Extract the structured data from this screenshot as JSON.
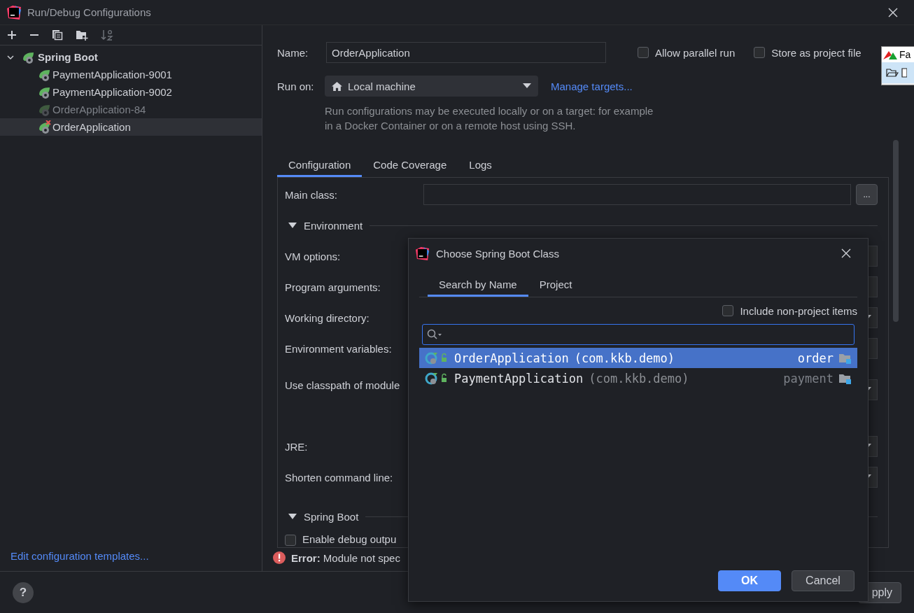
{
  "window": {
    "title": "Run/Debug Configurations"
  },
  "toolbar": [
    {
      "kind": "add",
      "disabled": false
    },
    {
      "kind": "remove",
      "disabled": false
    },
    {
      "kind": "copy",
      "disabled": false
    },
    {
      "kind": "new-folder",
      "disabled": false
    },
    {
      "kind": "sort",
      "disabled": true
    }
  ],
  "tree": [
    {
      "label": "Spring Boot",
      "expanded": true,
      "children": [
        {
          "label": "PaymentApplication-9001",
          "selected": false,
          "temporary": false,
          "error": false
        },
        {
          "label": "PaymentApplication-9002",
          "selected": false,
          "temporary": false,
          "error": false
        },
        {
          "label": "OrderApplication-84",
          "selected": false,
          "temporary": true,
          "error": false
        },
        {
          "label": "OrderApplication",
          "selected": true,
          "temporary": false,
          "error": true
        }
      ]
    }
  ],
  "templates_link": "Edit configuration templates...",
  "help_button": {
    "label": "?"
  },
  "form": {
    "name": {
      "label": "Name:",
      "value": "OrderApplication"
    },
    "options": [
      {
        "label": "Allow parallel run",
        "checked": false
      },
      {
        "label": "Store as project file",
        "checked": false
      }
    ],
    "run_on": {
      "label": "Run on:",
      "value": "Local machine",
      "link": "Manage targets..."
    },
    "hint": "Run configurations may be executed locally or on a target: for example in a Docker Container or on a remote host using SSH.",
    "tabs": [
      {
        "label": "Configuration",
        "selected": true
      },
      {
        "label": "Code Coverage",
        "selected": false
      },
      {
        "label": "Logs",
        "selected": false
      }
    ],
    "rows": [
      {
        "kind": "browse",
        "label": "Main class:",
        "button": "..."
      },
      {
        "kind": "section",
        "label": "Environment",
        "expanded": true
      },
      {
        "kind": "text",
        "label": "VM options:"
      },
      {
        "kind": "text",
        "label": "Program arguments:"
      },
      {
        "kind": "dropdown",
        "label": "Working directory:"
      },
      {
        "kind": "text",
        "label": "Environment variables:"
      },
      {
        "kind": "module",
        "label": "Use classpath of module"
      },
      {
        "kind": "dropdown",
        "label": "JRE:"
      },
      {
        "kind": "dropdown",
        "label": "Shorten command line:"
      },
      {
        "kind": "section",
        "label": "Spring Boot",
        "expanded": true
      },
      {
        "kind": "checkbox",
        "label": "Enable debug outpu",
        "checked": false
      }
    ],
    "error": "**Error:** Module not spec"
  },
  "footer_buttons": [
    {
      "label": "pply",
      "primary": false
    }
  ],
  "floating_window": {
    "title": "Fa"
  },
  "dialog": {
    "title": "Choose Spring Boot Class",
    "tabs": [
      {
        "label": "Search by Name",
        "selected": true
      },
      {
        "label": "Project",
        "selected": false
      }
    ],
    "include_option": {
      "label": "Include non-project items",
      "checked": false
    },
    "results": [
      {
        "name": "OrderApplication",
        "package": "(com.kkb.demo)",
        "module": "order",
        "selected": true
      },
      {
        "name": "PaymentApplication",
        "package": "(com.kkb.demo)",
        "module": "payment",
        "selected": false
      }
    ],
    "buttons": [
      {
        "label": "OK",
        "primary": true
      },
      {
        "label": "Cancel",
        "primary": false
      }
    ]
  }
}
